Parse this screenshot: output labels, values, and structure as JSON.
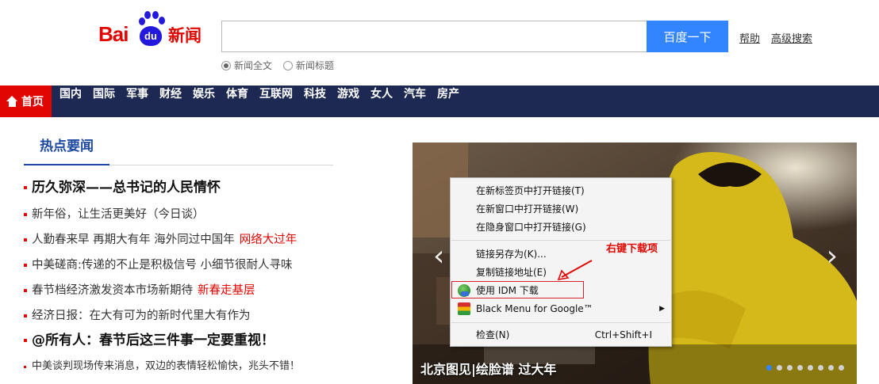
{
  "logo": {
    "text_bai": "Bai",
    "text_du": "du",
    "text_news": "新闻"
  },
  "search": {
    "value": "",
    "placeholder": "",
    "button": "百度一下"
  },
  "top_links": {
    "help": "帮助",
    "advanced": "高级搜索"
  },
  "search_scope": {
    "options": [
      "新闻全文",
      "新闻标题"
    ],
    "selected": "新闻全文"
  },
  "nav": {
    "home": "首页",
    "items": [
      "国内",
      "国际",
      "军事",
      "财经",
      "娱乐",
      "体育",
      "互联网",
      "科技",
      "游戏",
      "女人",
      "汽车",
      "房产"
    ]
  },
  "hot_news": {
    "title": "热点要闻",
    "items": [
      {
        "text": "历久弥深——总书记的人民情怀",
        "highlight": ""
      },
      {
        "text": "新年俗，让生活更美好（今日谈）",
        "highlight": ""
      },
      {
        "text": "人勤春来早 再期大有年 海外同过中国年",
        "highlight": "网络大过年"
      },
      {
        "text": "中美磋商:传递的不止是积极信号 小细节很耐人寻味",
        "highlight": ""
      },
      {
        "text": "春节档经济激发资本市场新期待",
        "highlight": "新春走基层"
      },
      {
        "text": "经济日报：在大有可为的新时代里大有作为",
        "highlight": ""
      },
      {
        "text": "@所有人：春节后这三件事一定要重视！",
        "highlight": ""
      },
      {
        "text": "中美谈判现场传来消息，双边的表情轻松愉快，兆头不错！",
        "highlight": ""
      }
    ]
  },
  "slider": {
    "caption": "北京图见|绘脸谱 过大年",
    "dot_count": 8,
    "active_dot": 0
  },
  "context_menu": {
    "items": [
      {
        "label": "在新标签页中打开链接(T)",
        "shortcut": ""
      },
      {
        "label": "在新窗口中打开链接(W)",
        "shortcut": ""
      },
      {
        "label": "在隐身窗口中打开链接(G)",
        "shortcut": ""
      },
      {
        "label": "链接另存为(K)...",
        "shortcut": ""
      },
      {
        "label": "复制链接地址(E)",
        "shortcut": ""
      },
      {
        "label": "使用 IDM 下载",
        "shortcut": ""
      },
      {
        "label": "Black Menu for Google™",
        "shortcut": ""
      },
      {
        "label": "检查(N)",
        "shortcut": "Ctrl+Shift+I"
      }
    ],
    "annotation": "右键下载项"
  },
  "colors": {
    "brand_red": "#e10601",
    "brand_blue": "#2319dc",
    "nav_bg": "#1d2952",
    "button_blue": "#3385ff"
  }
}
